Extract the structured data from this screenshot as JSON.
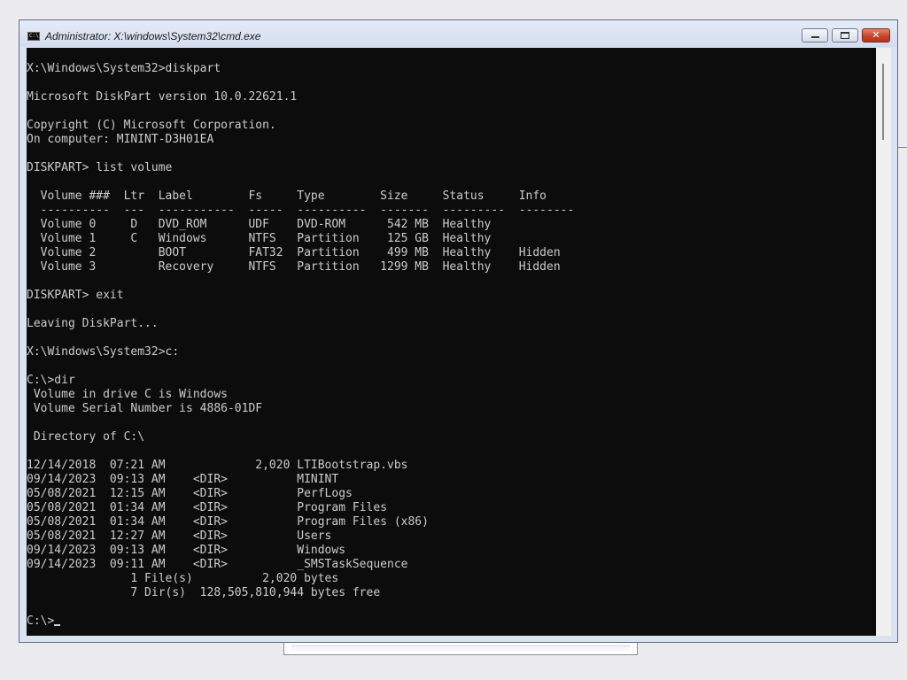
{
  "window": {
    "title": "Administrator: X:\\windows\\System32\\cmd.exe",
    "icon": "console-icon",
    "icon_text": "C:\\"
  },
  "console": {
    "lines": [
      "X:\\Windows\\System32>diskpart",
      "",
      "Microsoft DiskPart version 10.0.22621.1",
      "",
      "Copyright (C) Microsoft Corporation.",
      "On computer: MININT-D3H01EA",
      "",
      "DISKPART> list volume",
      "",
      "  Volume ###  Ltr  Label        Fs     Type        Size     Status     Info",
      "  ----------  ---  -----------  -----  ----------  -------  ---------  --------",
      "  Volume 0     D   DVD_ROM      UDF    DVD-ROM      542 MB  Healthy",
      "  Volume 1     C   Windows      NTFS   Partition    125 GB  Healthy",
      "  Volume 2         BOOT         FAT32  Partition    499 MB  Healthy    Hidden",
      "  Volume 3         Recovery     NTFS   Partition   1299 MB  Healthy    Hidden",
      "",
      "DISKPART> exit",
      "",
      "Leaving DiskPart...",
      "",
      "X:\\Windows\\System32>c:",
      "",
      "C:\\>dir",
      " Volume in drive C is Windows",
      " Volume Serial Number is 4886-01DF",
      "",
      " Directory of C:\\",
      "",
      "12/14/2018  07:21 AM             2,020 LTIBootstrap.vbs",
      "09/14/2023  09:13 AM    <DIR>          MININT",
      "05/08/2021  12:15 AM    <DIR>          PerfLogs",
      "05/08/2021  01:34 AM    <DIR>          Program Files",
      "05/08/2021  01:34 AM    <DIR>          Program Files (x86)",
      "05/08/2021  12:27 AM    <DIR>          Users",
      "09/14/2023  09:13 AM    <DIR>          Windows",
      "09/14/2023  09:11 AM    <DIR>          _SMSTaskSequence",
      "               1 File(s)          2,020 bytes",
      "               7 Dir(s)  128,505,810,944 bytes free",
      "",
      "C:\\>"
    ],
    "prompt_line_index": 39
  },
  "controls": {
    "minimize_icon": "minimize-icon",
    "maximize_icon": "maximize-icon",
    "close_icon": "close-icon",
    "close_glyph": "✕"
  },
  "colors": {
    "console_bg": "#0c0c0c",
    "console_fg": "#cccccc",
    "close_button": "#c5432b",
    "titlebar": "#dbe3f1"
  }
}
